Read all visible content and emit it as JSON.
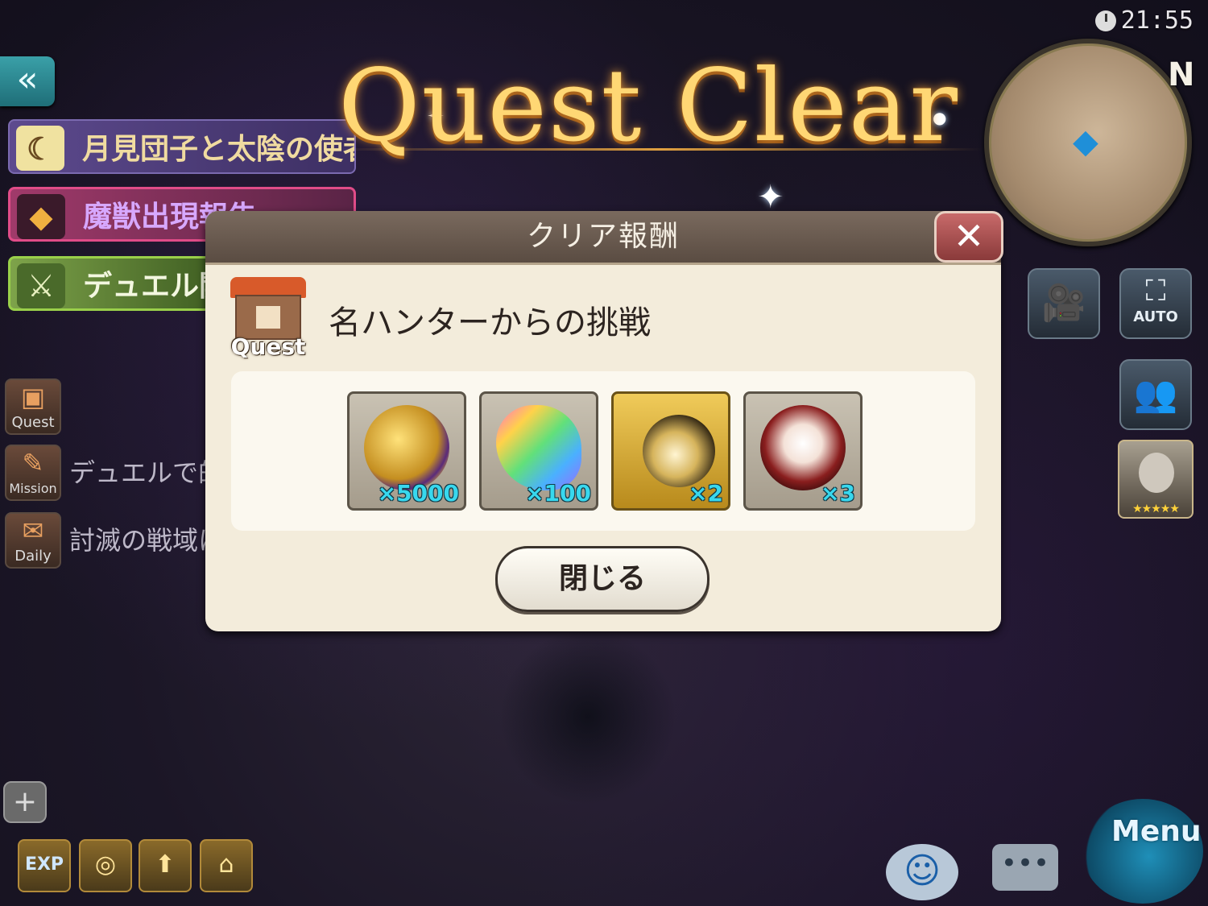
{
  "status": {
    "time": "21:55"
  },
  "title": "Quest Clear",
  "banners": {
    "event": "月見団子と太陰の使者",
    "beast": "魔獣出現報告",
    "duel": "デュエル開催"
  },
  "side_menu": [
    {
      "icon_label": "Quest",
      "text": ""
    },
    {
      "icon_label": "Mission",
      "text": "デュエルで的"
    },
    {
      "icon_label": "Daily",
      "text": "討滅の戦域に"
    }
  ],
  "minimap": {
    "north_label": "N"
  },
  "right_buttons": {
    "auto_label": "AUTO",
    "portrait_stars": "★★★★★"
  },
  "dialog": {
    "title": "クリア報酬",
    "quest_badge": "Quest",
    "quest_name": "名ハンターからの挑戦",
    "rewards": [
      {
        "icon": "gold-coin-medal-icon",
        "quantity": "×5000"
      },
      {
        "icon": "rainbow-crystal-icon",
        "quantity": "×100"
      },
      {
        "icon": "golden-charm-icon",
        "quantity": "×2"
      },
      {
        "icon": "tsukimi-dango-plate-icon",
        "quantity": "×3"
      }
    ],
    "close_button": "閉じる"
  },
  "bottom_bar": {
    "exp_label": "EXP",
    "menu_label": "Menu"
  },
  "colors": {
    "title_gold": "#ffd774",
    "quantity_cyan": "#38d8ee",
    "dialog_bg": "#f3ecdb"
  }
}
